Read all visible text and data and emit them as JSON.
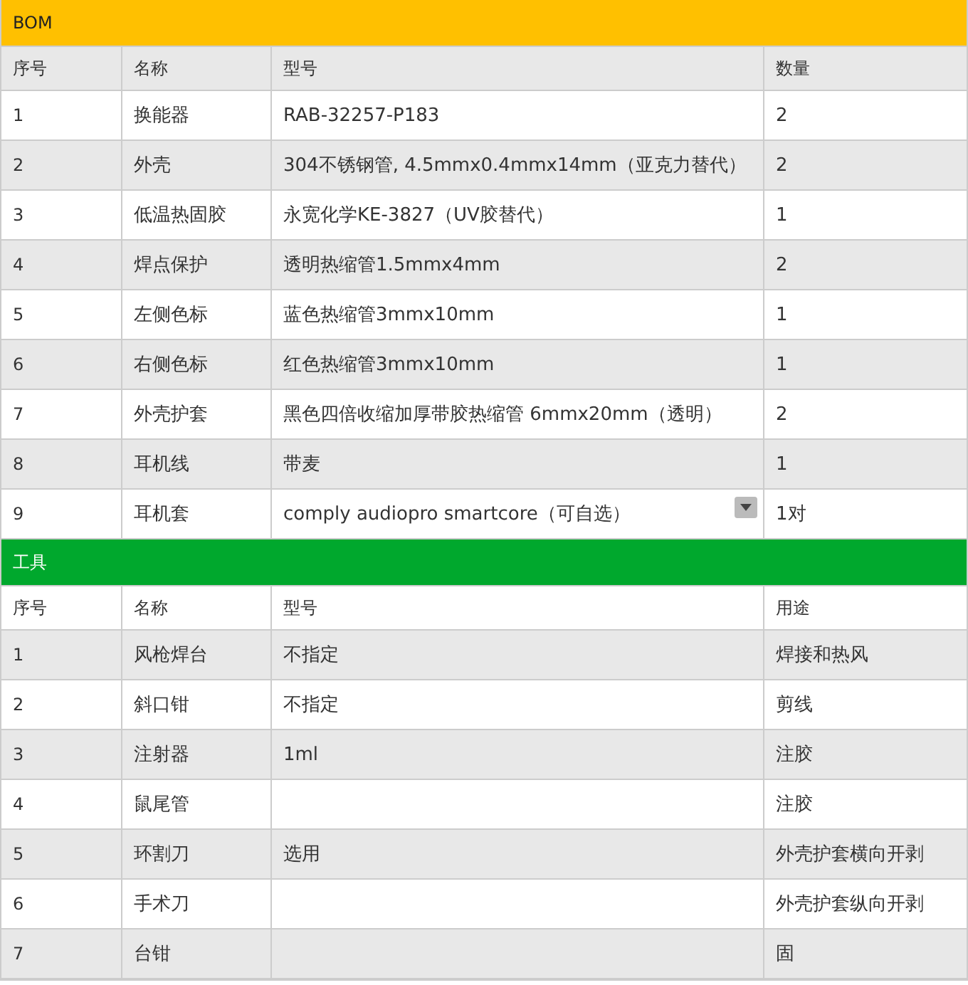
{
  "sections": [
    {
      "title": "BOM",
      "color": "#ffc000",
      "columns": [
        "序号",
        "名称",
        "型号",
        "数量"
      ],
      "rows": [
        {
          "cells": [
            "1",
            "换能器",
            "RAB-32257-P183",
            "2"
          ],
          "dropdown": false
        },
        {
          "cells": [
            "2",
            "外壳",
            "304不锈钢管, 4.5mmx0.4mmx14mm（亚克力替代）",
            "2"
          ],
          "dropdown": false
        },
        {
          "cells": [
            "3",
            "低温热固胶",
            "永宽化学KE-3827（UV胶替代）",
            "1"
          ],
          "dropdown": false
        },
        {
          "cells": [
            "4",
            "焊点保护",
            "透明热缩管1.5mmx4mm",
            "2"
          ],
          "dropdown": false
        },
        {
          "cells": [
            "5",
            "左侧色标",
            "蓝色热缩管3mmx10mm",
            "1"
          ],
          "dropdown": false
        },
        {
          "cells": [
            "6",
            "右侧色标",
            "红色热缩管3mmx10mm",
            "1"
          ],
          "dropdown": false
        },
        {
          "cells": [
            "7",
            "外壳护套",
            "黑色四倍收缩加厚带胶热缩管 6mmx20mm（透明）",
            "2"
          ],
          "dropdown": false
        },
        {
          "cells": [
            "8",
            "耳机线",
            "带麦",
            "1"
          ],
          "dropdown": false
        },
        {
          "cells": [
            "9",
            "耳机套",
            "comply audiopro smartcore（可自选）",
            "1对"
          ],
          "dropdown": true
        }
      ]
    },
    {
      "title": "工具",
      "color": "#00a82d",
      "columns": [
        "序号",
        "名称",
        "型号",
        "用途"
      ],
      "rows": [
        {
          "cells": [
            "1",
            "风枪焊台",
            "不指定",
            "焊接和热风"
          ],
          "dropdown": false
        },
        {
          "cells": [
            "2",
            "斜口钳",
            "不指定",
            "剪线"
          ],
          "dropdown": false
        },
        {
          "cells": [
            "3",
            "注射器",
            "1ml",
            "注胶"
          ],
          "dropdown": false
        },
        {
          "cells": [
            "4",
            "鼠尾管",
            "",
            "注胶"
          ],
          "dropdown": false
        },
        {
          "cells": [
            "5",
            "环割刀",
            "选用",
            "外壳护套横向开剥"
          ],
          "dropdown": false
        },
        {
          "cells": [
            "6",
            "手术刀",
            "",
            "外壳护套纵向开剥"
          ],
          "dropdown": false
        },
        {
          "cells": [
            "7",
            "台钳",
            "",
            "固"
          ],
          "dropdown": false
        }
      ]
    }
  ]
}
